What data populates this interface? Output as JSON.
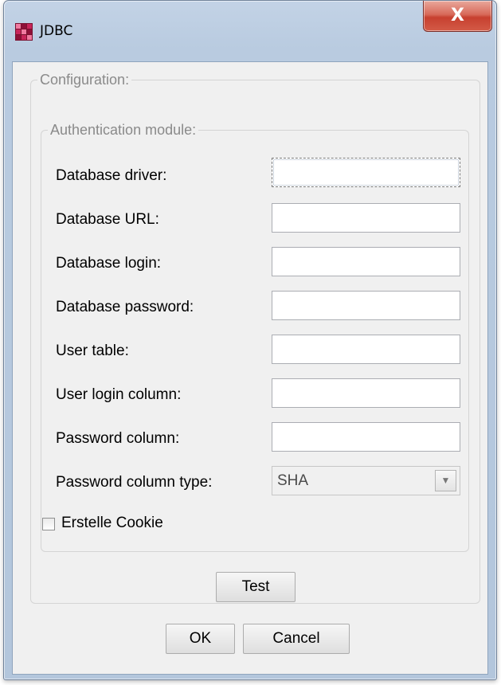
{
  "window": {
    "title": "JDBC",
    "close_label": "X"
  },
  "configuration": {
    "legend": "Configuration:",
    "auth": {
      "legend": "Authentication module:",
      "fields": [
        {
          "label": "Database driver:",
          "value": ""
        },
        {
          "label": "Database URL:",
          "value": ""
        },
        {
          "label": "Database login:",
          "value": ""
        },
        {
          "label": "Database password:",
          "value": ""
        },
        {
          "label": "User table:",
          "value": ""
        },
        {
          "label": "User login column:",
          "value": ""
        },
        {
          "label": "Password column:",
          "value": ""
        }
      ],
      "column_type": {
        "label": "Password column type:",
        "value": "SHA"
      },
      "cookie": {
        "label": "Erstelle Cookie",
        "checked": false
      }
    },
    "test_label": "Test"
  },
  "buttons": {
    "ok": "OK",
    "cancel": "Cancel"
  },
  "colors": {
    "close_button": "#c7402f",
    "dialog_bg": "#f0f0f0",
    "frame": "#b9cbe0",
    "legend_text": "#8a8a8a"
  },
  "icons": {
    "app": "jdbc-app-icon",
    "dropdown": "chevron-down-icon"
  }
}
